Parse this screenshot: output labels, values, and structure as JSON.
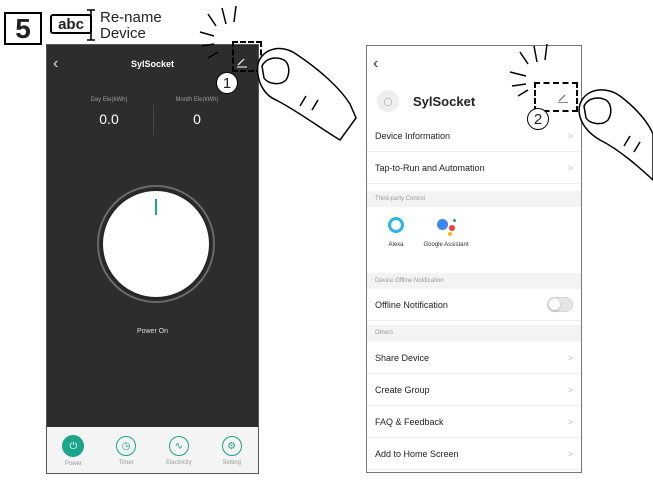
{
  "step": {
    "number": "5",
    "icon_text": "abc",
    "label_line1": "Re-name",
    "label_line2": "Device"
  },
  "left_screen": {
    "title": "SylSocket",
    "back_icon": "chevron-left-icon",
    "edit_icon": "pencil-icon",
    "stats": [
      {
        "label": "Day Ele(kWh)",
        "value": "0.0"
      },
      {
        "label": "Month Ele(kWh)",
        "value": "0"
      }
    ],
    "power_state": "Power On",
    "tabs": [
      {
        "label": "Power",
        "icon": "power-icon",
        "active": true
      },
      {
        "label": "Timer",
        "icon": "clock-icon",
        "active": false
      },
      {
        "label": "Electricity",
        "icon": "electricity-icon",
        "active": false
      },
      {
        "label": "Setting",
        "icon": "gear-icon",
        "active": false
      }
    ],
    "accent_color": "#1aa58c"
  },
  "callouts": [
    "1",
    "2"
  ],
  "right_screen": {
    "back_icon": "chevron-left-icon",
    "device_name": "SylSocket",
    "edit_icon": "pencil-icon",
    "rows": {
      "device_information": "Device Information",
      "tap_to_run": "Tap-to-Run and Automation",
      "offline_notification": "Offline Notification",
      "share_device": "Share Device",
      "create_group": "Create Group",
      "faq": "FAQ & Feedback",
      "add_home": "Add to Home Screen"
    },
    "sections": {
      "third_party": "Third-party Control",
      "offline": "Device Offline Notification",
      "others": "Others"
    },
    "assistants": [
      {
        "name": "Alexa",
        "icon": "alexa-icon"
      },
      {
        "name": "Google Assistant",
        "icon": "google-assistant-icon"
      }
    ],
    "offline_toggle_on": false,
    "chevron": ">"
  }
}
